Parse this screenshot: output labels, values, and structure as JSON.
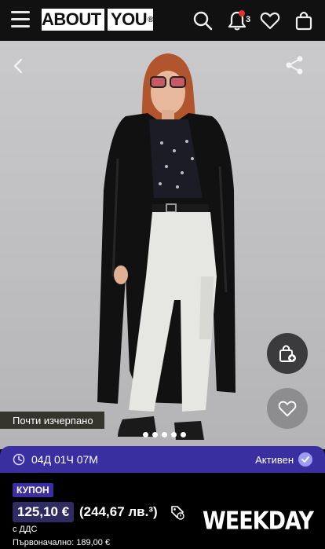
{
  "header": {
    "logo_left": "ABOUT",
    "logo_right": "YOU",
    "logo_mark": "®",
    "notifications_count": "3",
    "icons": [
      "menu-icon",
      "search-icon",
      "bell-icon",
      "heart-icon",
      "shopping-bag-icon"
    ]
  },
  "product": {
    "stock_label": "Почти изчерпано",
    "gallery_dot_count": 5,
    "icons": [
      "chevron-left-icon",
      "share-icon",
      "add-to-bag-icon",
      "heart-icon"
    ]
  },
  "timer": {
    "time": "04Д 01Ч 07М",
    "status": "Активен",
    "icons": [
      "clock-icon",
      "check-icon"
    ]
  },
  "pricing": {
    "coupon_label": "КУПОН",
    "price": "125,10 €",
    "price_bgn": "(244,67 лв.³)",
    "vat_note": "с ДДС",
    "original_price": "Първоначално: 189,00 €"
  },
  "brand": "WEEKDAY",
  "colors": {
    "header_bg": "#111111",
    "accent": "#3a2fa0",
    "price_box": "#2f2b63",
    "background": "#000000"
  }
}
